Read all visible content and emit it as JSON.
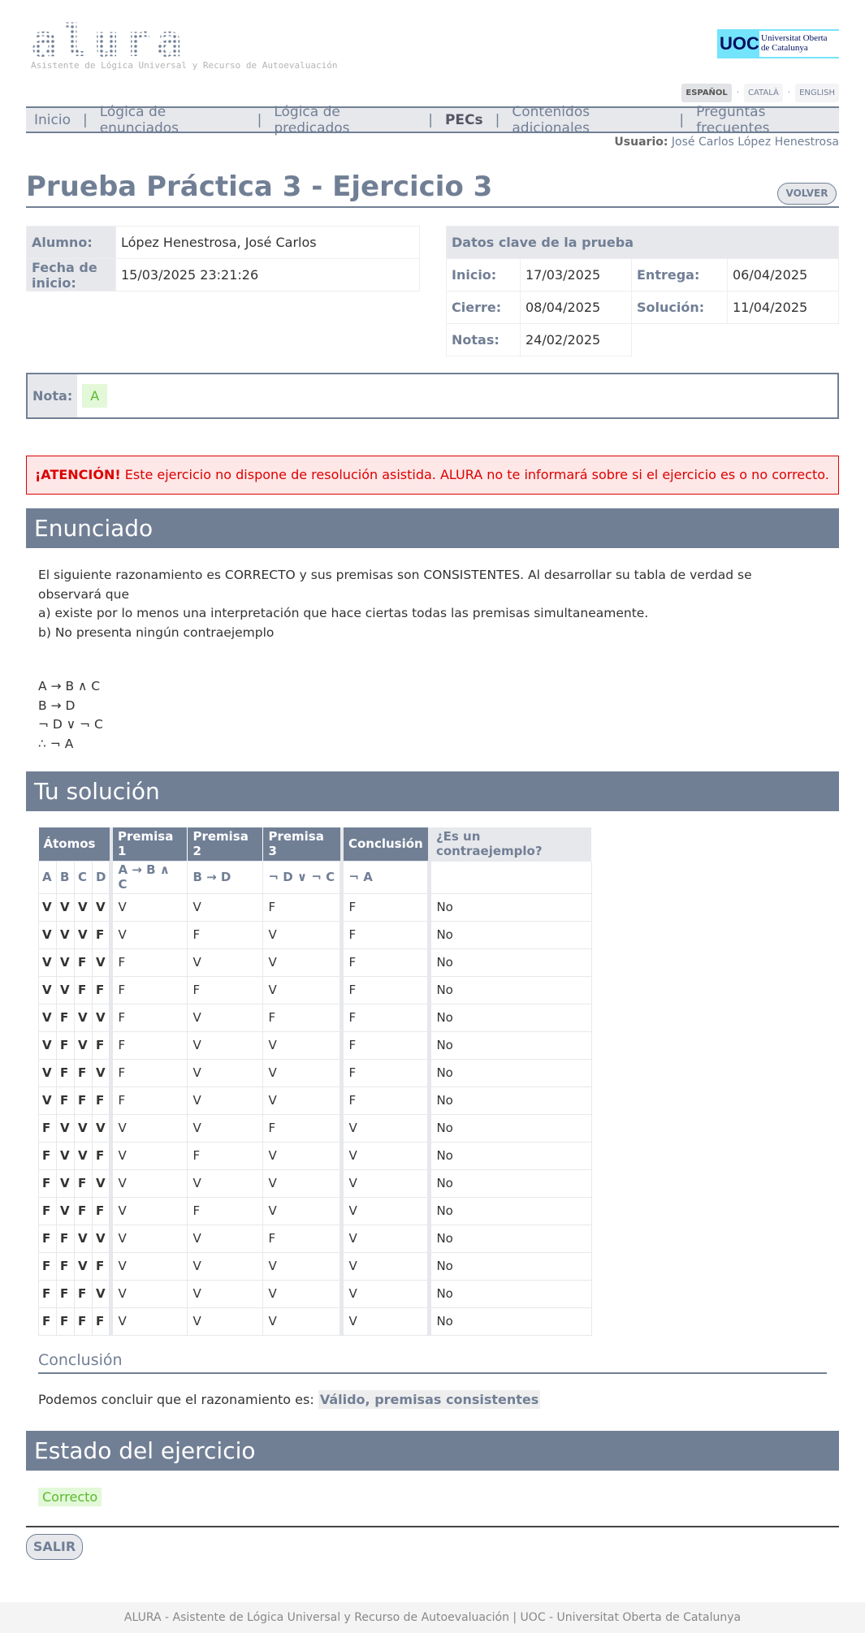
{
  "header": {
    "logo": "alura",
    "subtitle": "Asistente de Lógica Universal y Recurso de Autoevaluación",
    "uoc_mark": "UOC",
    "uoc_name_1": "Universitat Oberta",
    "uoc_name_2": "de Catalunya"
  },
  "langs": [
    "ESPAÑOL",
    "CATALÀ",
    "ENGLISH"
  ],
  "nav": [
    "Inicio",
    "Lógica de enunciados",
    "Lógica de predicados",
    "PECs",
    "Contenidos adicionales",
    "Preguntas frecuentes"
  ],
  "user": {
    "label": "Usuario:",
    "name": "José Carlos López Henestrosa"
  },
  "title": "Prueba Práctica 3 - Ejercicio 3",
  "volver": "VOLVER",
  "student": {
    "alumno_label": "Alumno:",
    "alumno": "López Henestrosa, José Carlos",
    "fecha_label": "Fecha de inicio:",
    "fecha": "15/03/2025 23:21:26"
  },
  "key": {
    "title": "Datos clave de la prueba",
    "inicio_label": "Inicio:",
    "inicio": "17/03/2025",
    "entrega_label": "Entrega:",
    "entrega": "06/04/2025",
    "cierre_label": "Cierre:",
    "cierre": "08/04/2025",
    "solucion_label": "Solución:",
    "solucion": "11/04/2025",
    "notas_label": "Notas:",
    "notas": "24/02/2025"
  },
  "nota": {
    "label": "Nota:",
    "value": "A"
  },
  "attention": {
    "strong": "¡ATENCIÓN!",
    "text": " Este ejercicio no dispone de resolución asistida. ALURA no te informará sobre si el ejercicio es o no correcto."
  },
  "enunciado": {
    "title": "Enunciado",
    "lines": [
      "El siguiente razonamiento es CORRECTO y sus premisas son CONSISTENTES. Al desarrollar su tabla de verdad se",
      "observará que",
      "a) existe por lo menos una interpretación que hace ciertas todas las premisas simultaneamente.",
      "b) No presenta ningún contraejemplo"
    ],
    "formulas": [
      "A → B ∧ C",
      "B → D",
      "¬ D ∨ ¬ C",
      "∴ ¬ A"
    ]
  },
  "solution": {
    "title": "Tu solución",
    "headers": [
      "Átomos",
      "Premisa 1",
      "Premisa 2",
      "Premisa 3",
      "Conclusión",
      "¿Es un contraejemplo?"
    ],
    "atoms": [
      "A",
      "B",
      "C",
      "D"
    ],
    "formulas": [
      "A → B ∧ C",
      "B → D",
      "¬ D ∨ ¬ C",
      "¬ A"
    ],
    "rows": [
      [
        "V",
        "V",
        "V",
        "V",
        "V",
        "V",
        "F",
        "F",
        "No"
      ],
      [
        "V",
        "V",
        "V",
        "F",
        "V",
        "F",
        "V",
        "F",
        "No"
      ],
      [
        "V",
        "V",
        "F",
        "V",
        "F",
        "V",
        "V",
        "F",
        "No"
      ],
      [
        "V",
        "V",
        "F",
        "F",
        "F",
        "F",
        "V",
        "F",
        "No"
      ],
      [
        "V",
        "F",
        "V",
        "V",
        "F",
        "V",
        "F",
        "F",
        "No"
      ],
      [
        "V",
        "F",
        "V",
        "F",
        "F",
        "V",
        "V",
        "F",
        "No"
      ],
      [
        "V",
        "F",
        "F",
        "V",
        "F",
        "V",
        "V",
        "F",
        "No"
      ],
      [
        "V",
        "F",
        "F",
        "F",
        "F",
        "V",
        "V",
        "F",
        "No"
      ],
      [
        "F",
        "V",
        "V",
        "V",
        "V",
        "V",
        "F",
        "V",
        "No"
      ],
      [
        "F",
        "V",
        "V",
        "F",
        "V",
        "F",
        "V",
        "V",
        "No"
      ],
      [
        "F",
        "V",
        "F",
        "V",
        "V",
        "V",
        "V",
        "V",
        "No"
      ],
      [
        "F",
        "V",
        "F",
        "F",
        "V",
        "F",
        "V",
        "V",
        "No"
      ],
      [
        "F",
        "F",
        "V",
        "V",
        "V",
        "V",
        "F",
        "V",
        "No"
      ],
      [
        "F",
        "F",
        "V",
        "F",
        "V",
        "V",
        "V",
        "V",
        "No"
      ],
      [
        "F",
        "F",
        "F",
        "V",
        "V",
        "V",
        "V",
        "V",
        "No"
      ],
      [
        "F",
        "F",
        "F",
        "F",
        "V",
        "V",
        "V",
        "V",
        "No"
      ]
    ]
  },
  "conclusion": {
    "title": "Conclusión",
    "text": "Podemos concluir que el razonamiento es: ",
    "value": "Válido, premisas consistentes"
  },
  "estado": {
    "title": "Estado del ejercicio",
    "value": "Correcto"
  },
  "salir": "SALIR",
  "footer": "ALURA - Asistente de Lógica Universal y Recurso de Autoevaluación | UOC - Universitat Oberta de Catalunya"
}
